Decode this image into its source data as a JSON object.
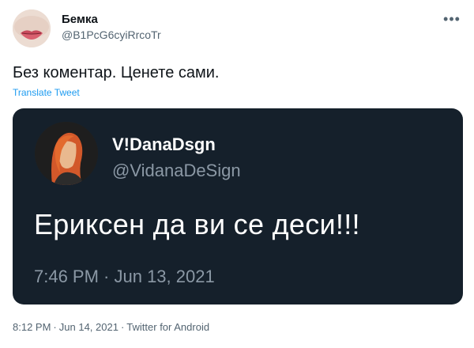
{
  "author": {
    "display_name": "Бемка",
    "handle": "@B1PcG6cyiRrcoTr"
  },
  "tweet": {
    "text": "Без коментар. Ценете сами.",
    "translate_label": "Translate Tweet"
  },
  "more_icon": "more-horizontal-icon",
  "quoted": {
    "display_name": "V!DanaDsgn",
    "handle": "@VidanaDeSign",
    "text": "Ериксен да ви се деси!!!",
    "timestamp": "7:46 PM · Jun 13, 2021",
    "background_color": "#15202b"
  },
  "meta": {
    "time": "8:12 PM",
    "date": "Jun 14, 2021",
    "client": "Twitter for Android",
    "separator": "·"
  },
  "colors": {
    "link": "#1d9bf0",
    "secondary_text": "#536471"
  }
}
